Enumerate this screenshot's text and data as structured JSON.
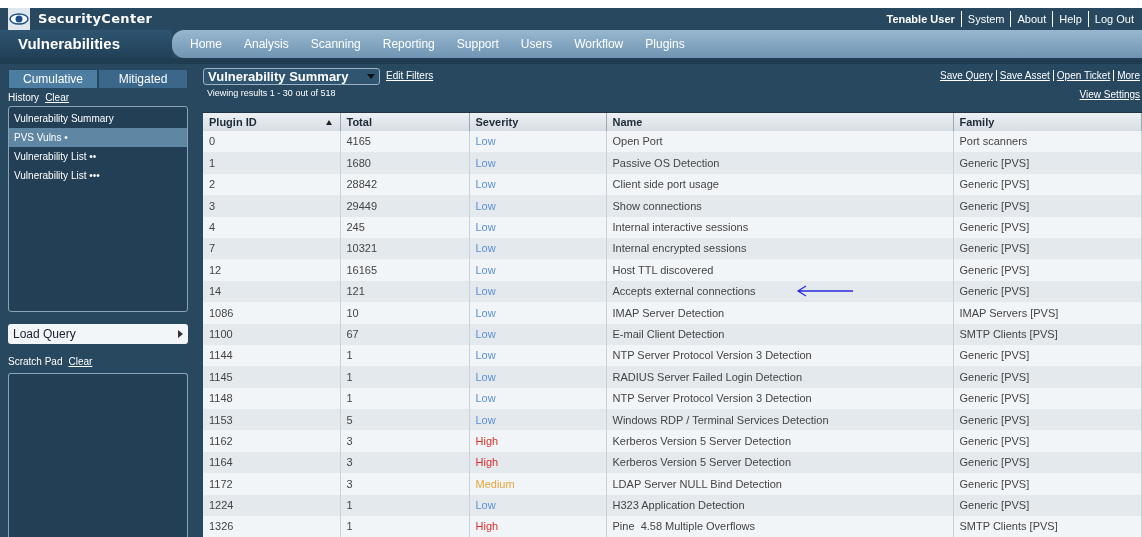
{
  "app": {
    "title": "SecurityCenter",
    "user": "Tenable User",
    "links": [
      "System",
      "About",
      "Help",
      "Log Out"
    ]
  },
  "section_title": "Vulnerabilities",
  "nav": [
    "Home",
    "Analysis",
    "Scanning",
    "Reporting",
    "Support",
    "Users",
    "Workflow",
    "Plugins"
  ],
  "sidebar": {
    "tabs": [
      {
        "label": "Cumulative",
        "selected": true
      },
      {
        "label": "Mitigated",
        "selected": false
      }
    ],
    "history_label": "History",
    "history_clear": "Clear",
    "history": [
      {
        "label": "Vulnerability Summary",
        "selected": false
      },
      {
        "label": "PVS Vulns",
        "dots": "•",
        "selected": true
      },
      {
        "label": "Vulnerability List",
        "dots": "••",
        "selected": false
      },
      {
        "label": "Vulnerability List",
        "dots": "•••",
        "selected": false
      }
    ],
    "load_query": "Load Query",
    "scratch_label": "Scratch Pad",
    "scratch_clear": "Clear"
  },
  "toolbar": {
    "view": "Vulnerability Summary",
    "edit_filters": "Edit Filters",
    "viewing": "Viewing results 1 - 30 out of 518",
    "actions": [
      "Save Query",
      "Save Asset",
      "Open Ticket",
      "More"
    ],
    "view_settings": "View Settings"
  },
  "table": {
    "columns": [
      {
        "label": "Plugin ID",
        "sorted": true
      },
      {
        "label": "Total",
        "sorted": false
      },
      {
        "label": "Severity",
        "sorted": false
      },
      {
        "label": "Name",
        "sorted": false
      },
      {
        "label": "Family",
        "sorted": false
      }
    ],
    "rows": [
      {
        "id": "0",
        "total": "4165",
        "severity": "Low",
        "color": "#5b8fd6",
        "name": "Open Port",
        "family": "Port scanners",
        "flagged": false
      },
      {
        "id": "1",
        "total": "1680",
        "severity": "Low",
        "color": "#5b8fd6",
        "name": "Passive OS Detection",
        "family": "Generic [PVS]",
        "flagged": false
      },
      {
        "id": "2",
        "total": "28842",
        "severity": "Low",
        "color": "#5b8fd6",
        "name": "Client side port usage",
        "family": "Generic [PVS]",
        "flagged": false
      },
      {
        "id": "3",
        "total": "29449",
        "severity": "Low",
        "color": "#5b8fd6",
        "name": "Show connections",
        "family": "Generic [PVS]",
        "flagged": false
      },
      {
        "id": "4",
        "total": "245",
        "severity": "Low",
        "color": "#5b8fd6",
        "name": "Internal interactive sessions",
        "family": "Generic [PVS]",
        "flagged": false
      },
      {
        "id": "7",
        "total": "10321",
        "severity": "Low",
        "color": "#5b8fd6",
        "name": "Internal encrypted sessions",
        "family": "Generic [PVS]",
        "flagged": false
      },
      {
        "id": "12",
        "total": "16165",
        "severity": "Low",
        "color": "#5b8fd6",
        "name": "Host TTL discovered",
        "family": "Generic [PVS]",
        "flagged": false
      },
      {
        "id": "14",
        "total": "121",
        "severity": "Low",
        "color": "#5b8fd6",
        "name": "Accepts external connections",
        "family": "Generic [PVS]",
        "flagged": true
      },
      {
        "id": "1086",
        "total": "10",
        "severity": "Low",
        "color": "#5b8fd6",
        "name": "IMAP Server Detection",
        "family": "IMAP Servers [PVS]",
        "flagged": false
      },
      {
        "id": "1100",
        "total": "67",
        "severity": "Low",
        "color": "#5b8fd6",
        "name": "E-mail Client Detection",
        "family": "SMTP Clients [PVS]",
        "flagged": false
      },
      {
        "id": "1144",
        "total": "1",
        "severity": "Low",
        "color": "#5b8fd6",
        "name": "NTP Server Protocol Version 3 Detection",
        "family": "Generic [PVS]",
        "flagged": false
      },
      {
        "id": "1145",
        "total": "1",
        "severity": "Low",
        "color": "#5b8fd6",
        "name": "RADIUS Server Failed Login Detection",
        "family": "Generic [PVS]",
        "flagged": false
      },
      {
        "id": "1148",
        "total": "1",
        "severity": "Low",
        "color": "#5b8fd6",
        "name": "NTP Server Protocol Version 3 Detection",
        "family": "Generic [PVS]",
        "flagged": false
      },
      {
        "id": "1153",
        "total": "5",
        "severity": "Low",
        "color": "#5b8fd6",
        "name": "Windows RDP / Terminal Services Detection",
        "family": "Generic [PVS]",
        "flagged": false
      },
      {
        "id": "1162",
        "total": "3",
        "severity": "High",
        "color": "#d9302c",
        "name": "Kerberos Version 5 Server Detection",
        "family": "Generic [PVS]",
        "flagged": false
      },
      {
        "id": "1164",
        "total": "3",
        "severity": "High",
        "color": "#d9302c",
        "name": "Kerberos Version 5 Server Detection",
        "family": "Generic [PVS]",
        "flagged": false
      },
      {
        "id": "1172",
        "total": "3",
        "severity": "Medium",
        "color": "#e8a33d",
        "name": "LDAP Server NULL Bind Detection",
        "family": "Generic [PVS]",
        "flagged": false
      },
      {
        "id": "1224",
        "total": "1",
        "severity": "Low",
        "color": "#5b8fd6",
        "name": "H323 Application Detection",
        "family": "Generic [PVS]",
        "flagged": false
      },
      {
        "id": "1326",
        "total": "1",
        "severity": "High",
        "color": "#d9302c",
        "name": "Pine  4.58 Multiple Overflows",
        "family": "SMTP Clients [PVS]",
        "flagged": false
      }
    ]
  }
}
